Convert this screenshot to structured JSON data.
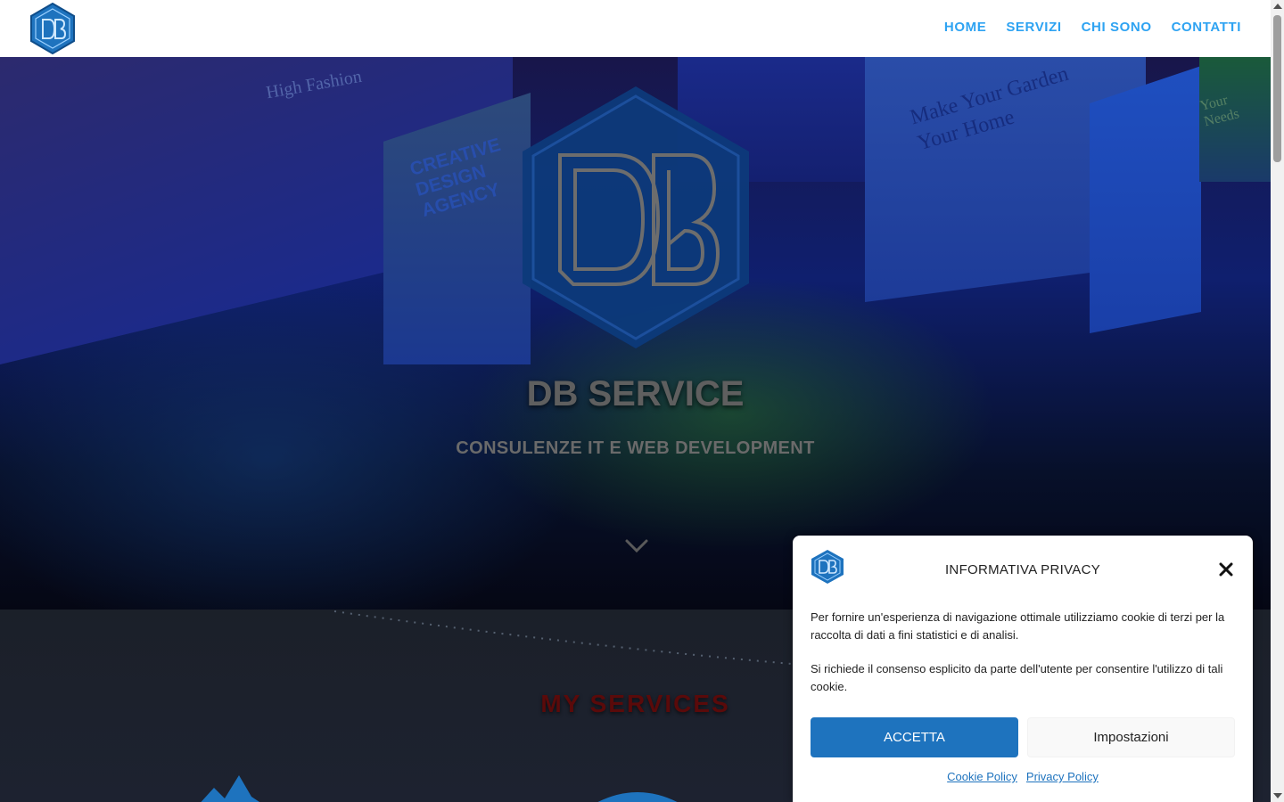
{
  "header": {
    "nav": [
      {
        "label": "HOME"
      },
      {
        "label": "SERVIZI"
      },
      {
        "label": "CHI SONO"
      },
      {
        "label": "CONTATTI"
      }
    ]
  },
  "hero": {
    "title": "DB SERVICE",
    "subtitle": "CONSULENZE IT E WEB DEVELOPMENT",
    "background_panels": {
      "panel_1_text": "High Fashion",
      "panel_2_text": [
        "CREATIVE",
        "DESIGN",
        "AGENCY"
      ],
      "panel_4_text": [
        "Make Your Garden",
        "Your Home"
      ],
      "panel_6_text": [
        "Your",
        "Needs"
      ]
    },
    "scroll_icon": "chevron-down-icon"
  },
  "services": {
    "title": "MY SERVICES"
  },
  "privacy_modal": {
    "title": "INFORMATIVA PRIVACY",
    "paragraph_1": "Per fornire un'esperienza di navigazione ottimale utilizziamo cookie di terzi per la raccolta di dati a fini statistici e di analisi.",
    "paragraph_2": "Si richiede il consenso esplicito da parte dell'utente per consentire l'utilizzo di tali cookie.",
    "accept_label": "ACCETTA",
    "settings_label": "Impostazioni",
    "links": [
      {
        "label": "Cookie Policy"
      },
      {
        "label": "Privacy Policy"
      }
    ],
    "close_icon": "close-icon"
  },
  "colors": {
    "nav_link": "#2ea3f2",
    "accept_button": "#1e73be",
    "logo_blue": "#1e73be"
  }
}
